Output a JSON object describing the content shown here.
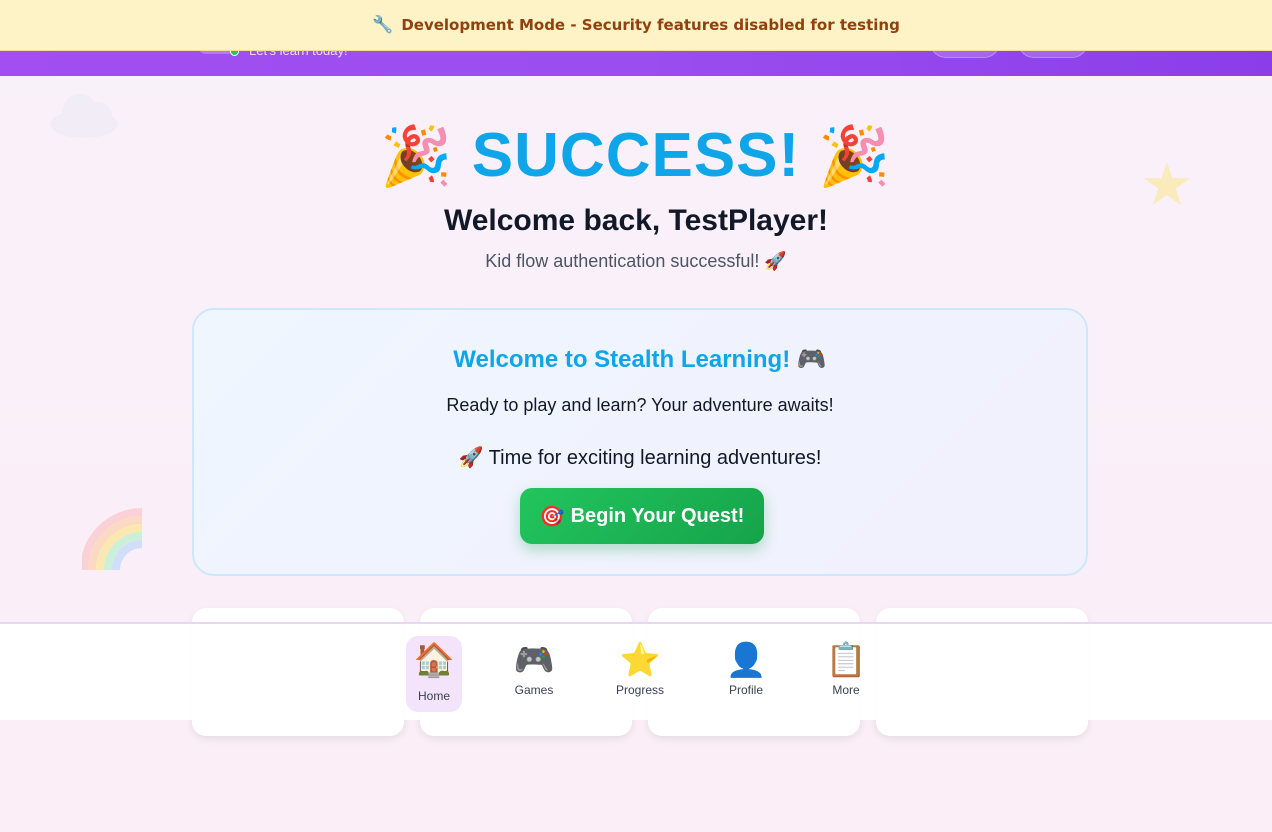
{
  "dev_banner": {
    "icon": "wrench-icon",
    "icon_glyph": "🔧",
    "text": "Development Mode - Security features disabled for testing"
  },
  "header": {
    "subtitle": "Let's learn today!"
  },
  "hero": {
    "emoji_left": "🎉",
    "title": "SUCCESS!",
    "emoji_right": "🎉",
    "welcome": "Welcome back, TestPlayer!",
    "auth_message": "Kid flow authentication successful! 🚀"
  },
  "card": {
    "title": "Welcome to Stealth Learning!",
    "title_emoji": "🎮",
    "text": "Ready to play and learn? Your adventure awaits!",
    "adventure": "🚀 Time for exciting learning adventures!",
    "button_emoji": "🎯",
    "button_label": "Begin Your Quest!"
  },
  "bottom_nav": {
    "items": [
      {
        "icon": "house-icon",
        "glyph": "🏠",
        "label": "Home",
        "active": true
      },
      {
        "icon": "game-controller-icon",
        "glyph": "🎮",
        "label": "Games",
        "active": false
      },
      {
        "icon": "star-icon",
        "glyph": "⭐",
        "label": "Progress",
        "active": false
      },
      {
        "icon": "person-icon",
        "glyph": "👤",
        "label": "Profile",
        "active": false
      },
      {
        "icon": "clipboard-icon",
        "glyph": "📋",
        "label": "More",
        "active": false
      }
    ]
  },
  "colors": {
    "header_purple": "#9a4ef0",
    "banner_bg": "#fef3c7",
    "banner_text": "#92400e",
    "title_blue": "#0ea5e9",
    "button_green": "#22c55e",
    "active_nav_bg": "#f3e4fb"
  }
}
